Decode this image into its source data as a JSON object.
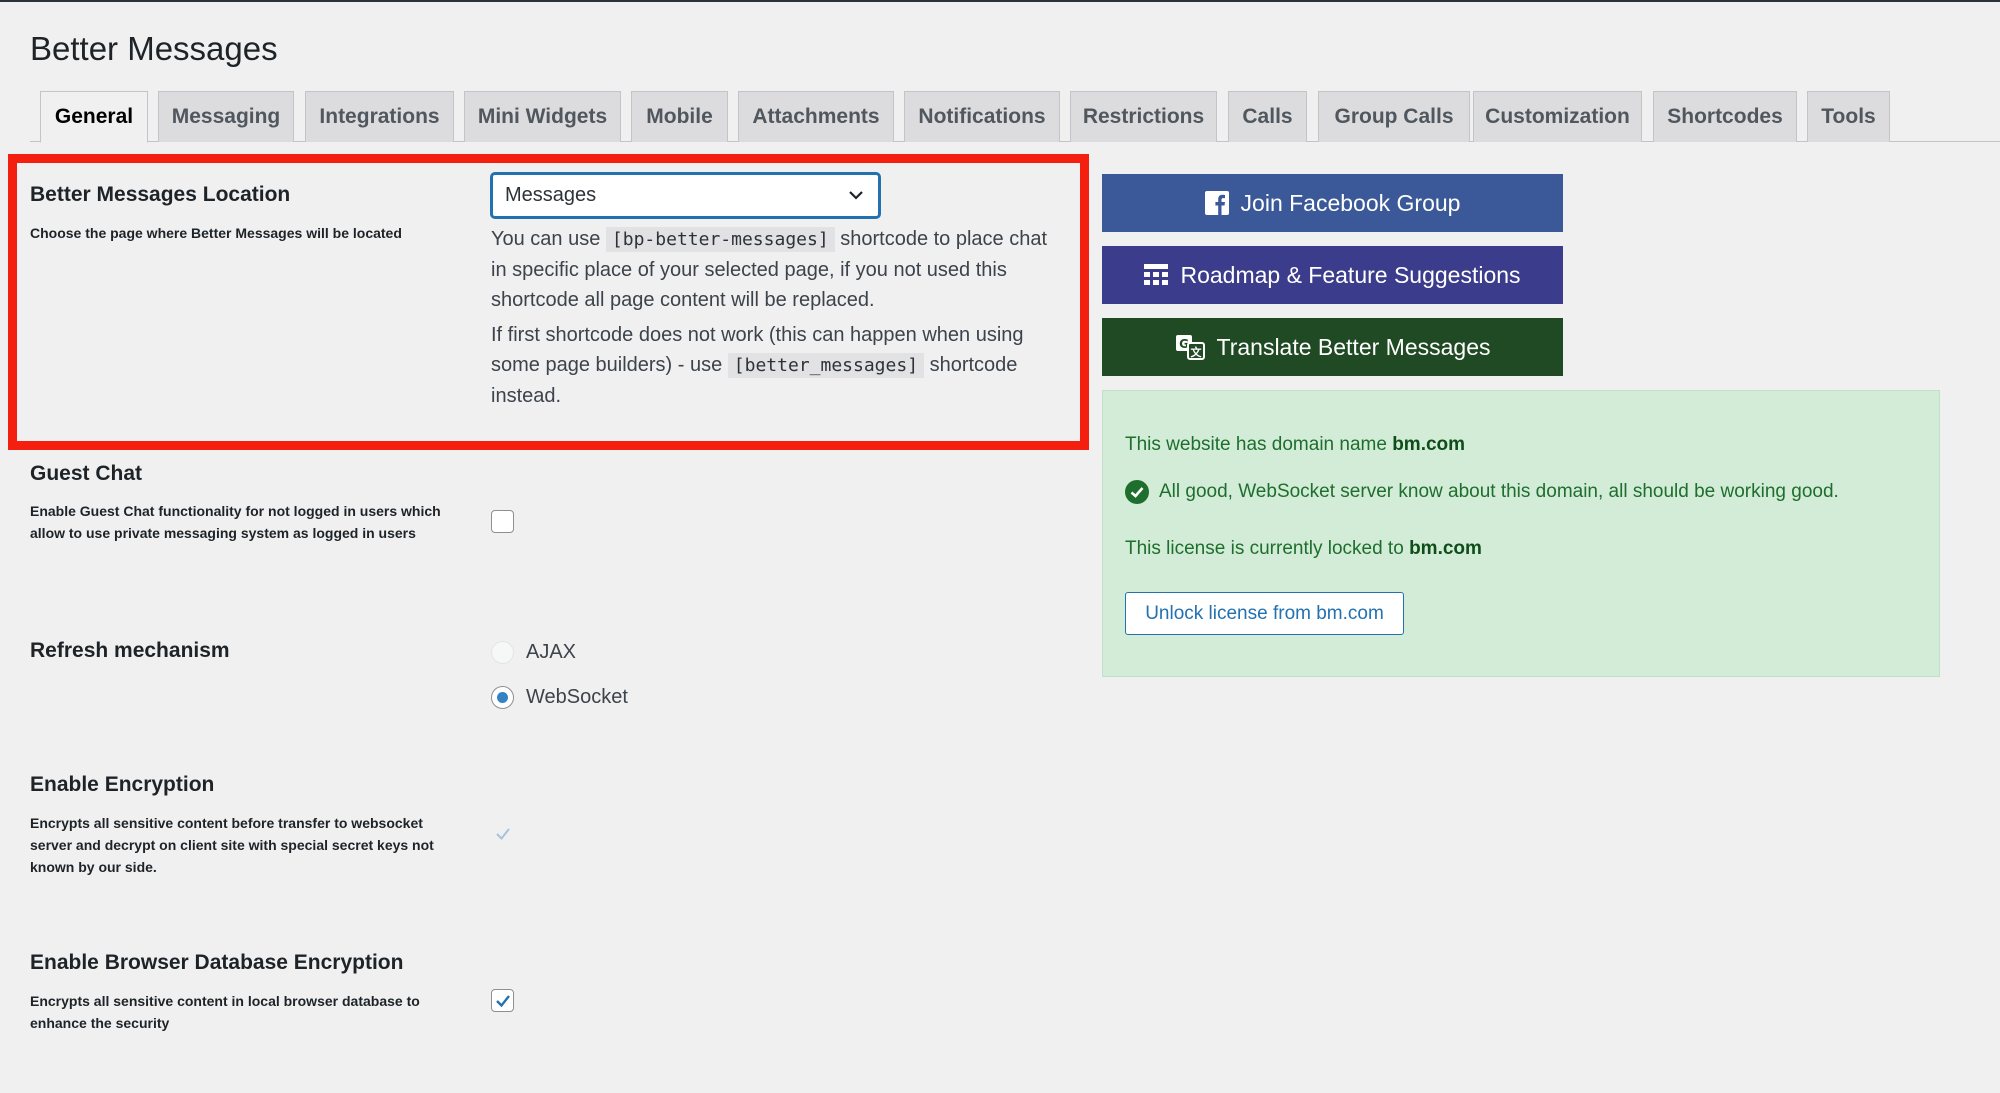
{
  "page": {
    "title": "Better Messages"
  },
  "tabs": [
    {
      "label": "General"
    },
    {
      "label": "Messaging"
    },
    {
      "label": "Integrations"
    },
    {
      "label": "Mini Widgets"
    },
    {
      "label": "Mobile"
    },
    {
      "label": "Attachments"
    },
    {
      "label": "Notifications"
    },
    {
      "label": "Restrictions"
    },
    {
      "label": "Calls"
    },
    {
      "label": "Group Calls"
    },
    {
      "label": "Customization"
    },
    {
      "label": "Shortcodes"
    },
    {
      "label": "Tools"
    }
  ],
  "active_tab": "General",
  "location": {
    "label": "Better Messages Location",
    "description": "Choose the page where Better Messages will be located",
    "selected": "Messages",
    "help1_pre": "You can use ",
    "help1_code": "[bp-better-messages]",
    "help1_post": " shortcode to place chat in specific place of your selected page, if you not used this shortcode all page content will be replaced.",
    "help2_pre": "If first shortcode does not work (this can happen when using some page builders) - use ",
    "help2_code": "[better_messages]",
    "help2_post": " shortcode instead."
  },
  "guest_chat": {
    "label": "Guest Chat",
    "description": "Enable Guest Chat functionality for not logged in users which allow to use private messaging system as logged in users",
    "checked": false
  },
  "refresh": {
    "label": "Refresh mechanism",
    "options": [
      {
        "label": "AJAX",
        "selected": false,
        "disabled": true
      },
      {
        "label": "WebSocket",
        "selected": true,
        "disabled": false
      }
    ]
  },
  "encryption": {
    "label": "Enable Encryption",
    "description": "Encrypts all sensitive content before transfer to websocket server and decrypt on client site with special secret keys not known by our side.",
    "checked": true,
    "disabled": true
  },
  "db_encryption": {
    "label": "Enable Browser Database Encryption",
    "description": "Encrypts all sensitive content in local browser database to enhance the security",
    "checked": true
  },
  "side_buttons": {
    "facebook": {
      "label": "Join Facebook Group",
      "color": "#3b5998",
      "icon": "facebook-icon"
    },
    "roadmap": {
      "label": "Roadmap & Feature Suggestions",
      "color": "#3b3c8c",
      "icon": "roadmap-icon"
    },
    "translate": {
      "label": "Translate Better Messages",
      "color": "#1f4a23",
      "icon": "translate-icon"
    }
  },
  "license": {
    "domain_pre": "This website has domain name ",
    "domain": "bm.com",
    "status": "All good, WebSocket server know about this domain, all should be working good.",
    "locked_pre": "This license is currently locked to ",
    "locked_domain": "bm.com",
    "unlock_label": "Unlock license from bm.com"
  },
  "colors": {
    "accent": "#2271b1",
    "highlight": "#f41f0e",
    "success_bg": "#d3ecd8",
    "success_text": "#1e6e2d"
  }
}
